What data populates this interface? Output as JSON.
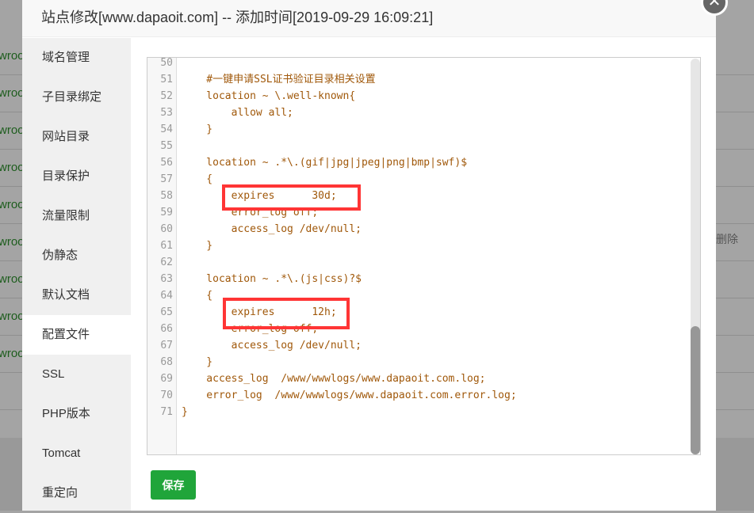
{
  "background": {
    "row_text": "wroo",
    "delete_label": "删除"
  },
  "dialog": {
    "title": "站点修改[www.dapaoit.com] -- 添加时间[2019-09-29 16:09:21]",
    "close_icon": "close-icon"
  },
  "sidebar": {
    "active": "配置文件",
    "items": [
      {
        "label": "域名管理"
      },
      {
        "label": "子目录绑定"
      },
      {
        "label": "网站目录"
      },
      {
        "label": "目录保护"
      },
      {
        "label": "流量限制"
      },
      {
        "label": "伪静态"
      },
      {
        "label": "默认文档"
      },
      {
        "label": "配置文件"
      },
      {
        "label": "SSL"
      },
      {
        "label": "PHP版本"
      },
      {
        "label": "Tomcat"
      },
      {
        "label": "重定向"
      }
    ]
  },
  "editor": {
    "lines": [
      {
        "n": "50",
        "t": ""
      },
      {
        "n": "51",
        "t": "    #一键申请SSL证书验证目录相关设置"
      },
      {
        "n": "52",
        "t": "    location ~ \\.well-known{"
      },
      {
        "n": "53",
        "t": "        allow all;"
      },
      {
        "n": "54",
        "t": "    }"
      },
      {
        "n": "55",
        "t": ""
      },
      {
        "n": "56",
        "t": "    location ~ .*\\.(gif|jpg|jpeg|png|bmp|swf)$"
      },
      {
        "n": "57",
        "t": "    {"
      },
      {
        "n": "58",
        "t": "        expires      30d;"
      },
      {
        "n": "59",
        "t": "        error_log off;"
      },
      {
        "n": "60",
        "t": "        access_log /dev/null;"
      },
      {
        "n": "61",
        "t": "    }"
      },
      {
        "n": "62",
        "t": ""
      },
      {
        "n": "63",
        "t": "    location ~ .*\\.(js|css)?$"
      },
      {
        "n": "64",
        "t": "    {"
      },
      {
        "n": "65",
        "t": "        expires      12h;"
      },
      {
        "n": "66",
        "t": "        error_log off;"
      },
      {
        "n": "67",
        "t": "        access_log /dev/null;"
      },
      {
        "n": "68",
        "t": "    }"
      },
      {
        "n": "69",
        "t": "    access_log  /www/wwwlogs/www.dapaoit.com.log;"
      },
      {
        "n": "70",
        "t": "    error_log  /www/wwwlogs/www.dapaoit.com.error.log;"
      },
      {
        "n": "71",
        "t": "}"
      }
    ],
    "highlight_color": "#ff3535",
    "code_color": "#a0580a"
  },
  "save_label": "保存",
  "accent": "#20a53a"
}
